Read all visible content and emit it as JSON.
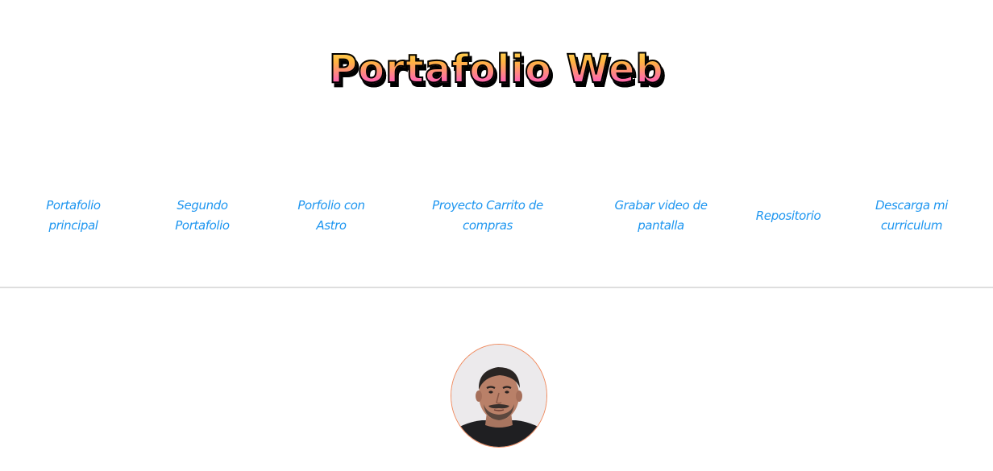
{
  "header": {
    "title": "Portafolio Web"
  },
  "nav": {
    "items": [
      {
        "label": "Portafolio principal"
      },
      {
        "label": "Segundo Portafolio"
      },
      {
        "label": "Porfolio con Astro"
      },
      {
        "label": "Proyecto Carrito de compras"
      },
      {
        "label": "Grabar video de pantalla"
      },
      {
        "label": "Repositorio"
      },
      {
        "label": "Descarga mi curriculum"
      }
    ]
  },
  "colors": {
    "link": "#1e96f0",
    "title_gradient_top": "#ffe45c",
    "title_gradient_bottom": "#ff3fa3",
    "divider": "#dedede",
    "avatar_border": "#f08a5e"
  },
  "icons": {
    "avatar": "profile-photo"
  }
}
